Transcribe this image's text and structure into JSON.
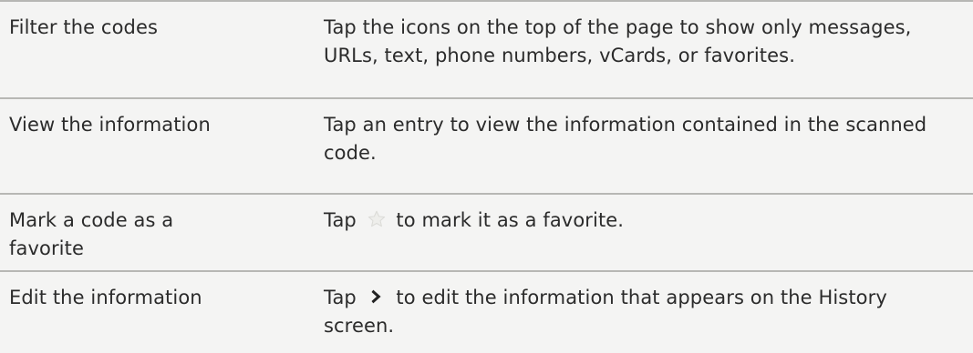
{
  "rows": [
    {
      "action": "Filter the codes",
      "description": "Tap the icons on the top of the page to show only messages, URLs, text, phone numbers, vCards, or favorites."
    },
    {
      "action": "View the information",
      "description": "Tap an entry to view the information contained in the scanned code."
    },
    {
      "action": "Mark a code as a favorite",
      "description_before": "Tap",
      "icon": "star-icon",
      "description_after": "to mark it as a favorite."
    },
    {
      "action": "Edit the information",
      "description_before": "Tap",
      "icon": "chevron-right-icon",
      "description_after": "to edit the information that appears on the History screen."
    }
  ],
  "colors": {
    "background": "#f4f4f3",
    "divider": "#b7b7b4",
    "text": "#2b2b2b",
    "star_icon": "#e3e3e0"
  }
}
